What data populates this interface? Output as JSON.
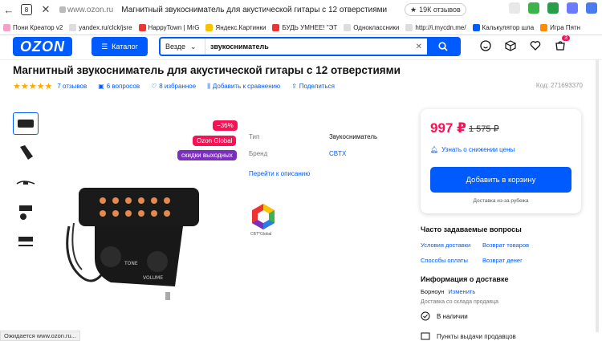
{
  "browser": {
    "back": "←",
    "tab_count": "8",
    "close": "✕",
    "url": "www.ozon.ru",
    "page_title": "Магнитный звукосниматель для акустической гитары с 12 отверстиями",
    "reviews_pill": "19К отзывов",
    "bookmarks": [
      {
        "label": "Пони Креатор v2",
        "color": "#f4a1c8"
      },
      {
        "label": "yandex.ru/clck/jsre",
        "color": "#ddd"
      },
      {
        "label": "HappyTown | MrG",
        "color": "#e33"
      },
      {
        "label": "Яндекс.Картинки",
        "color": "#f8c400"
      },
      {
        "label": "БУДЬ УМНЕЕ! \"ЭТ",
        "color": "#e33"
      },
      {
        "label": "Одноклассники",
        "color": "#ddd"
      },
      {
        "label": "http://i.mycdn.me/",
        "color": "#ddd"
      },
      {
        "label": "Калькулятор шла",
        "color": "#005bff"
      },
      {
        "label": "Игра Пятн",
        "color": "#ff8c00"
      }
    ]
  },
  "header": {
    "logo": "OZON",
    "catalog": "Каталог",
    "search_category": "Везде",
    "search_query": "звукосниматель",
    "cart_badge": "3"
  },
  "product": {
    "title": "Магнитный звукосниматель для акустической гитары с 12 отверстиями",
    "stars": "★★★★★",
    "reviews": "7 отзывов",
    "questions": "6 вопросов",
    "favorites": "8 избранное",
    "compare": "Добавить к сравнению",
    "share": "Поделиться",
    "code": "Код: 271693370",
    "discount": "−36%",
    "badge_global": "Ozon Global",
    "badge_weekend": "скидки выходных",
    "props": [
      {
        "key": "Тип",
        "value": "Звукосниматель"
      },
      {
        "key": "Бренд",
        "value": "CBTX"
      }
    ],
    "description_link": "Перейти к описанию",
    "brand_caption": "CBT*Global"
  },
  "buybox": {
    "price": "997 ₽",
    "old_price": "1 575 ₽",
    "notify": "Узнать о снижении цены",
    "cart_button": "Добавить в корзину",
    "delivery": "Доставка из-за рубежа"
  },
  "faq": {
    "title": "Часто задаваемые вопросы",
    "items": [
      "Условия доставки",
      "Возврат товаров",
      "Способы оплаты",
      "Возврат денег"
    ]
  },
  "delivery_info": {
    "title": "Информация о доставке",
    "city": "Борноун",
    "change": "Изменить",
    "nearest": "Доставка со склада продавца",
    "in_stock": "В наличии",
    "pickup": "Пункты выдачи продавцов"
  },
  "status_bar": "Ожидается www.ozon.ru..."
}
